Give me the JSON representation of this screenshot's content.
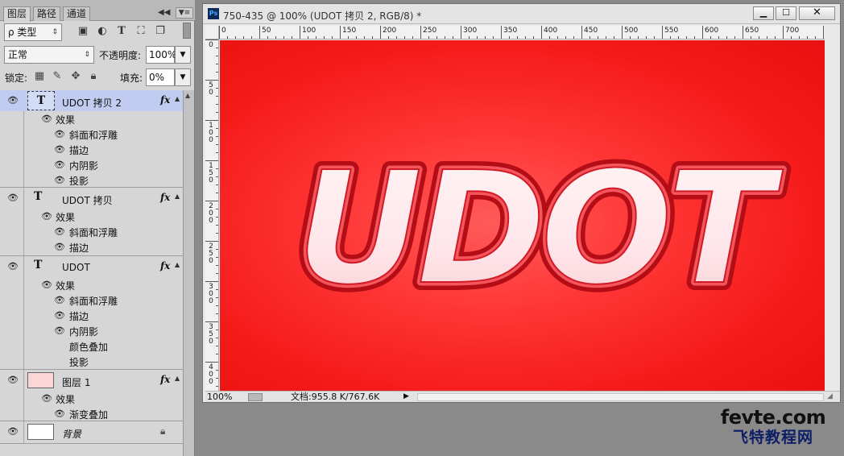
{
  "panel": {
    "tabs": [
      "图层",
      "路径",
      "通道"
    ],
    "collapse_glyph": "◀◀",
    "menu_glyph": "▼≡",
    "filter_label": "ρ 类型",
    "filter_icons": [
      "image-filter-icon",
      "adjustment-filter-icon",
      "type-filter-icon",
      "shape-filter-icon",
      "smart-object-filter-icon"
    ],
    "blend_mode": "正常",
    "opacity_label": "不透明度:",
    "opacity_value": "100%",
    "lock_label": "锁定:",
    "fill_label": "填充:",
    "fill_value": "0%"
  },
  "layers": [
    {
      "name": "UDOT 拷贝 2",
      "effects_label": "效果",
      "effects": [
        "斜面和浮雕",
        "描边",
        "内阴影",
        "投影"
      ]
    },
    {
      "name": "UDOT 拷贝",
      "effects_label": "效果",
      "effects": [
        "斜面和浮雕",
        "描边"
      ]
    },
    {
      "name": "UDOT",
      "effects_label": "效果",
      "effects": [
        "斜面和浮雕",
        "描边",
        "内阴影"
      ],
      "hidden_effects": [
        "颜色叠加",
        "投影"
      ]
    },
    {
      "name": "图层 1",
      "effects_label": "效果",
      "effects": [
        "渐变叠加"
      ]
    },
    {
      "name": "背景"
    }
  ],
  "document": {
    "title": "750-435 @ 100% (UDOT 拷贝 2, RGB/8) *",
    "ps_badge": "Ps",
    "min_glyph": "▁",
    "max_glyph": "☐",
    "close_glyph": "✕",
    "canvas_text": "UDOT",
    "h_ruler_labels": [
      "0",
      "50",
      "100",
      "150",
      "200",
      "250",
      "300",
      "350",
      "400",
      "450",
      "500",
      "550",
      "600",
      "650",
      "700"
    ],
    "v_ruler_labels": [
      "0",
      "50",
      "100",
      "150",
      "200",
      "250",
      "300",
      "350",
      "400"
    ],
    "zoom": "100%",
    "doc_size": "文档:955.8 K/767.6K",
    "status_arrow": "▶"
  },
  "watermark": {
    "top": "fevte.com",
    "bottom": "飞特教程网"
  }
}
